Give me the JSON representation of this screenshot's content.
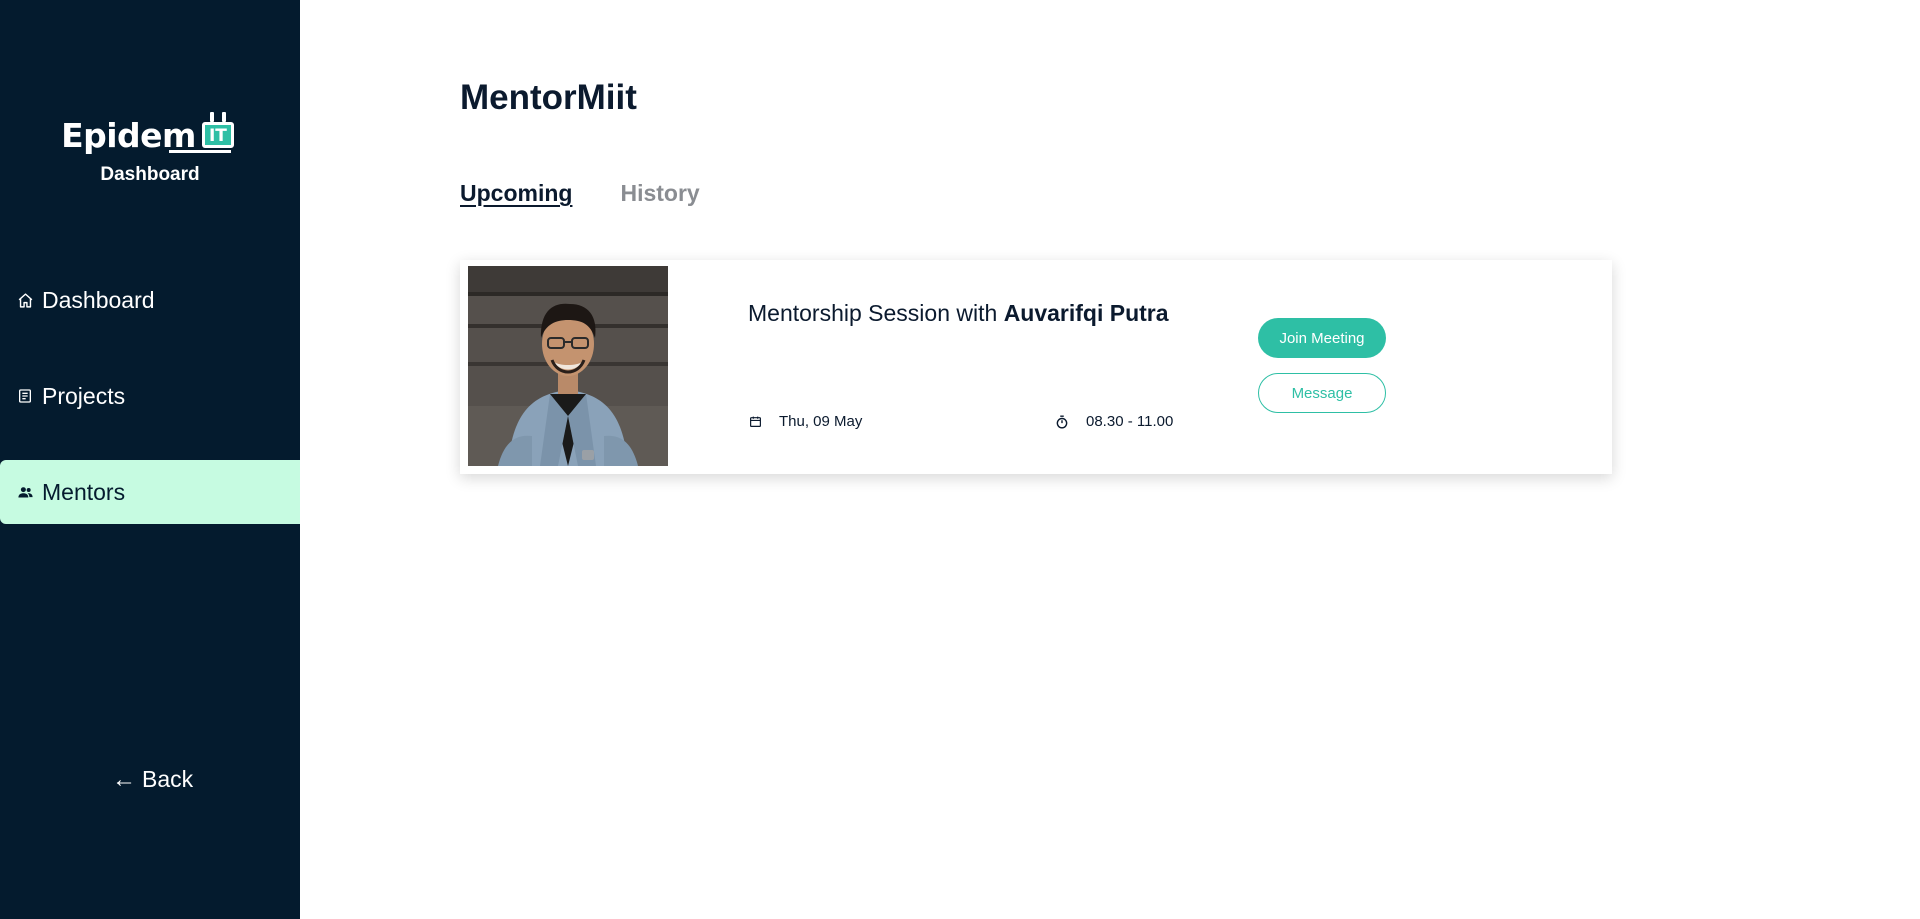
{
  "sidebar": {
    "logo": {
      "word": "Epidem",
      "badge": "IT",
      "subtitle": "Dashboard"
    },
    "items": [
      {
        "label": "Dashboard",
        "icon": "home-icon",
        "active": false
      },
      {
        "label": "Projects",
        "icon": "document-icon",
        "active": false
      },
      {
        "label": "Mentors",
        "icon": "people-icon",
        "active": true
      }
    ],
    "back": {
      "arrow": "←",
      "label": "Back"
    }
  },
  "main": {
    "title": "MentorMiit",
    "tabs": [
      {
        "label": "Upcoming",
        "active": true
      },
      {
        "label": "History",
        "active": false
      }
    ],
    "sessions": [
      {
        "title_prefix": "Mentorship Session with",
        "mentor_name": "Auvarifqi Putra",
        "date": "Thu, 09 May",
        "time": "08.30 - 11.00",
        "join_label": "Join Meeting",
        "message_label": "Message"
      }
    ]
  },
  "colors": {
    "sidebar_bg": "#041b2e",
    "active_nav_bg": "#c6fbe1",
    "accent": "#2ebfa5",
    "text_dark": "#0b1a2e",
    "tab_inactive": "#8a8d92"
  }
}
